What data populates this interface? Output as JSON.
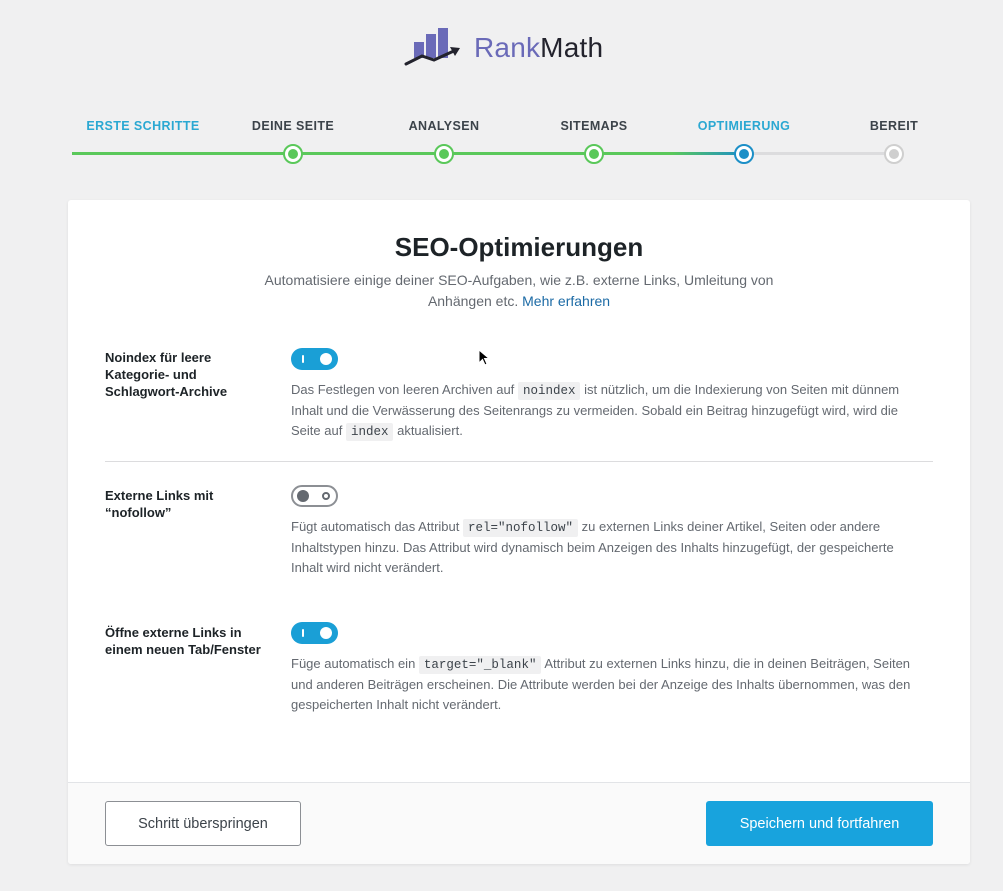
{
  "logo": {
    "rank": "Rank",
    "math": "Math"
  },
  "steps": [
    {
      "label": "ERSTE SCHRITTE",
      "state": "done"
    },
    {
      "label": "DEINE SEITE",
      "state": "done"
    },
    {
      "label": "ANALYSEN",
      "state": "done"
    },
    {
      "label": "SITEMAPS",
      "state": "done"
    },
    {
      "label": "OPTIMIERUNG",
      "state": "active"
    },
    {
      "label": "BEREIT",
      "state": "pending"
    }
  ],
  "colors": {
    "accent": "#18a3dd",
    "done": "#5ac85a",
    "pending": "#cfcfcf",
    "link": "#1b6aa5"
  },
  "card": {
    "title": "SEO-Optimierungen",
    "desc_line1": "Automatisiere einige deiner SEO-Aufgaben, wie z.B. externe Links, Umleitung von",
    "desc_line2": "Anhängen etc.",
    "learn_more": "Mehr erfahren"
  },
  "options": [
    {
      "label": "Noindex für leere Kategorie- und Schlagwort-Archive",
      "enabled": true,
      "desc_a": "Das Festlegen von leeren Archiven auf",
      "code_a": "noindex",
      "desc_b": "ist nützlich, um die Indexierung von Seiten mit dünnem Inhalt und die Verwässerung des Seitenrangs zu vermeiden. Sobald ein Beitrag hinzugefügt wird, wird die Seite auf",
      "code_b": "index",
      "desc_c": "aktualisiert."
    },
    {
      "label": "Externe Links mit “nofollow”",
      "enabled": false,
      "desc_a": "Fügt automatisch das Attribut",
      "code_a": "rel=\"nofollow\"",
      "desc_b": "zu externen Links deiner Artikel, Seiten oder andere Inhaltstypen hinzu. Das Attribut wird dynamisch beim Anzeigen des Inhalts hinzugefügt, der gespeicherte Inhalt wird nicht verändert."
    },
    {
      "label": "Öffne externe Links in einem neuen Tab/Fenster",
      "enabled": true,
      "desc_a": "Füge automatisch ein",
      "code_a": "target=\"_blank\"",
      "desc_b": "Attribut zu externen Links hinzu, die in deinen Beiträgen, Seiten und anderen Beiträgen erscheinen. Die Attribute werden bei der Anzeige des Inhalts übernommen, was den gespeicherten Inhalt nicht verändert."
    }
  ],
  "footer": {
    "skip_label": "Schritt überspringen",
    "save_label": "Speichern und fortfahren"
  }
}
